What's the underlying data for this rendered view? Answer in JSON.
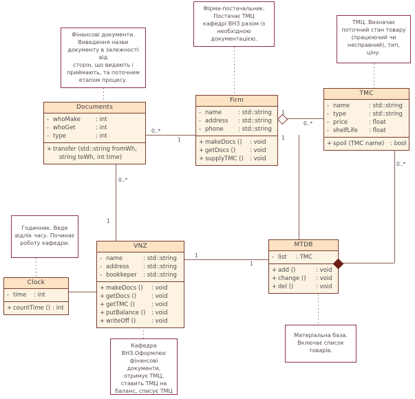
{
  "diagram": {
    "title": "UML Class Diagram",
    "colors": {
      "class_border": "#7a3b2e",
      "class_header_fill": "#fbe3c4",
      "class_body_fill": "#fdf3e3",
      "note_border": "#8b2f4a",
      "connector": "#8a5c52",
      "filled_diamond": "#6d1f17"
    }
  },
  "classes": [
    {
      "id": "documents",
      "name": "Documents",
      "attributes": [
        {
          "vis": "-",
          "name": "whoMake",
          "type": ": int"
        },
        {
          "vis": "-",
          "name": "whoGet",
          "type": ": int"
        },
        {
          "vis": "-",
          "name": "type",
          "type": ": int"
        }
      ],
      "operations": [
        {
          "vis": "+",
          "name": "transfer (std::string fromWh,",
          "cont": "string toWh, int time)"
        }
      ]
    },
    {
      "id": "firm",
      "name": "Firm",
      "attributes": [
        {
          "vis": "-",
          "name": "name",
          "type": ": std::string"
        },
        {
          "vis": "-",
          "name": "address",
          "type": ": std::string"
        },
        {
          "vis": "-",
          "name": "phone",
          "type": ": std::string"
        }
      ],
      "operations": [
        {
          "vis": "+",
          "name": "makeDocs ()",
          "type": ": void"
        },
        {
          "vis": "+",
          "name": "getDocs ()",
          "type": ": void"
        },
        {
          "vis": "+",
          "name": "supplyTMC ()",
          "type": ": void"
        }
      ]
    },
    {
      "id": "tmc",
      "name": "TMC",
      "attributes": [
        {
          "vis": "-",
          "name": "name",
          "type": ": std::string"
        },
        {
          "vis": "-",
          "name": "type",
          "type": ": std::string"
        },
        {
          "vis": "-",
          "name": "price",
          "type": ": float"
        },
        {
          "vis": "-",
          "name": "shelfLife",
          "type": ": float"
        }
      ],
      "operations": [
        {
          "vis": "+",
          "name": "spoil (TMC name)",
          "type": ": bool"
        }
      ]
    },
    {
      "id": "vnz",
      "name": "VNZ",
      "attributes": [
        {
          "vis": "-",
          "name": "name",
          "type": ": std::string"
        },
        {
          "vis": "-",
          "name": "address",
          "type": ": std::string"
        },
        {
          "vis": "-",
          "name": "bookkeper",
          "type": ": std::string"
        }
      ],
      "operations": [
        {
          "vis": "+",
          "name": "makeDocs ()",
          "type": ": void"
        },
        {
          "vis": "+",
          "name": "getDocs ()",
          "type": ": void"
        },
        {
          "vis": "+",
          "name": "getTMC ()",
          "type": ": void"
        },
        {
          "vis": "+",
          "name": "putBalance ()",
          "type": ": void"
        },
        {
          "vis": "+",
          "name": "writeOff ()",
          "type": ": void"
        }
      ]
    },
    {
      "id": "mtdb",
      "name": "MTDB",
      "attributes": [
        {
          "vis": "-",
          "name": "list",
          "type": ": TMC"
        }
      ],
      "operations": [
        {
          "vis": "+",
          "name": "add ()",
          "type": ": void"
        },
        {
          "vis": "+",
          "name": "change ()",
          "type": ": void"
        },
        {
          "vis": "+",
          "name": "del ()",
          "type": ": void"
        }
      ]
    },
    {
      "id": "clock",
      "name": "Clock",
      "attributes": [
        {
          "vis": "-",
          "name": "time",
          "type": ": int"
        }
      ],
      "operations": [
        {
          "vis": "+",
          "name": "countTime ()",
          "type": ": int"
        }
      ]
    }
  ],
  "notes": [
    {
      "id": "note-documents",
      "lines": [
        "Фінансові документи.",
        "Виведення назви",
        "документу в залежності від",
        "сторін, що видають і",
        "приймають, та поточним",
        "етапом процесу."
      ]
    },
    {
      "id": "note-firm",
      "lines": [
        "Фірма-постачальник.",
        "Постачає ТМЦ",
        "кафедрі ВНЗ разом із",
        "необхідною",
        "документацією."
      ]
    },
    {
      "id": "note-tmc",
      "lines": [
        "ТМЦ. Визначає",
        "поточний стан товару",
        "(працюючий чи",
        "несправний), тип,",
        "ціну."
      ]
    },
    {
      "id": "note-clock",
      "lines": [
        "Годинник. Веде",
        "відлік часу. Починає",
        "роботу кафедри."
      ]
    },
    {
      "id": "note-vnz",
      "lines": [
        "Кафедра",
        "ВНЗ.Оформлює",
        "фінансові документи,",
        "отримує ТМЦ,",
        "ставить ТМЦ на",
        "баланс, списує ТМЦ"
      ]
    },
    {
      "id": "note-mtdb",
      "lines": [
        "Матеріальна база.",
        "Включає список",
        "товарів."
      ]
    }
  ],
  "multiplicities": [
    {
      "id": "mult-documents-firm-left",
      "value": "0..*"
    },
    {
      "id": "mult-documents-firm-right",
      "value": "1"
    },
    {
      "id": "mult-firm-tmc-left",
      "value": "1"
    },
    {
      "id": "mult-firm-tmc-right",
      "value": "0..*"
    },
    {
      "id": "mult-firm-mtdb",
      "value": "1"
    },
    {
      "id": "mult-tmc-mtdb",
      "value": "0..*"
    },
    {
      "id": "mult-documents-vnz-top",
      "value": "0..*"
    },
    {
      "id": "mult-documents-vnz-bottom",
      "value": "1"
    },
    {
      "id": "mult-vnz-mtdb-left",
      "value": "1"
    },
    {
      "id": "mult-vnz-mtdb-right",
      "value": "1"
    }
  ]
}
